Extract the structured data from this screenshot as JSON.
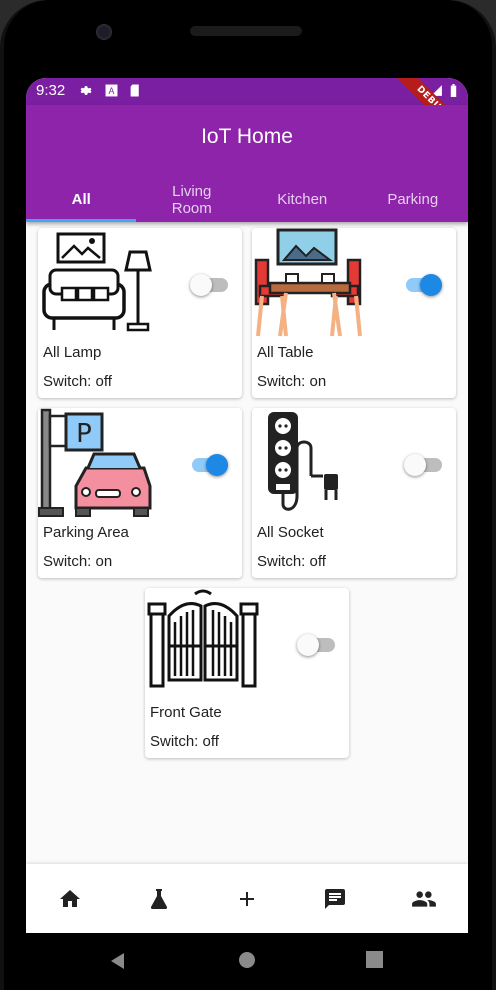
{
  "status_bar": {
    "time": "9:32",
    "debug_banner": "DEBUG"
  },
  "app": {
    "title": "IoT Home"
  },
  "tabs": [
    {
      "label": "All",
      "active": true
    },
    {
      "label": "Living\nRoom",
      "active": false
    },
    {
      "label": "Kitchen",
      "active": false
    },
    {
      "label": "Parking",
      "active": false
    }
  ],
  "devices": [
    {
      "name": "All Lamp",
      "switch_text": "Switch: off",
      "on": false,
      "icon": "living-room-lamp-icon"
    },
    {
      "name": "All Table",
      "switch_text": "Switch: on",
      "on": true,
      "icon": "dining-table-icon"
    },
    {
      "name": "Parking Area",
      "switch_text": "Switch: on",
      "on": true,
      "icon": "parking-car-icon"
    },
    {
      "name": "All Socket",
      "switch_text": "Switch: off",
      "on": false,
      "icon": "power-socket-icon"
    },
    {
      "name": "Front Gate",
      "switch_text": "Switch: off",
      "on": false,
      "icon": "gate-icon"
    }
  ],
  "bottom_nav": [
    "home-icon",
    "flask-icon",
    "add-icon",
    "chat-icon",
    "people-icon"
  ],
  "colors": {
    "appbar": "#8e24aa",
    "statusbar": "#7b1fa2",
    "accent": "#1e88e5",
    "indicator": "#42a5f5"
  }
}
